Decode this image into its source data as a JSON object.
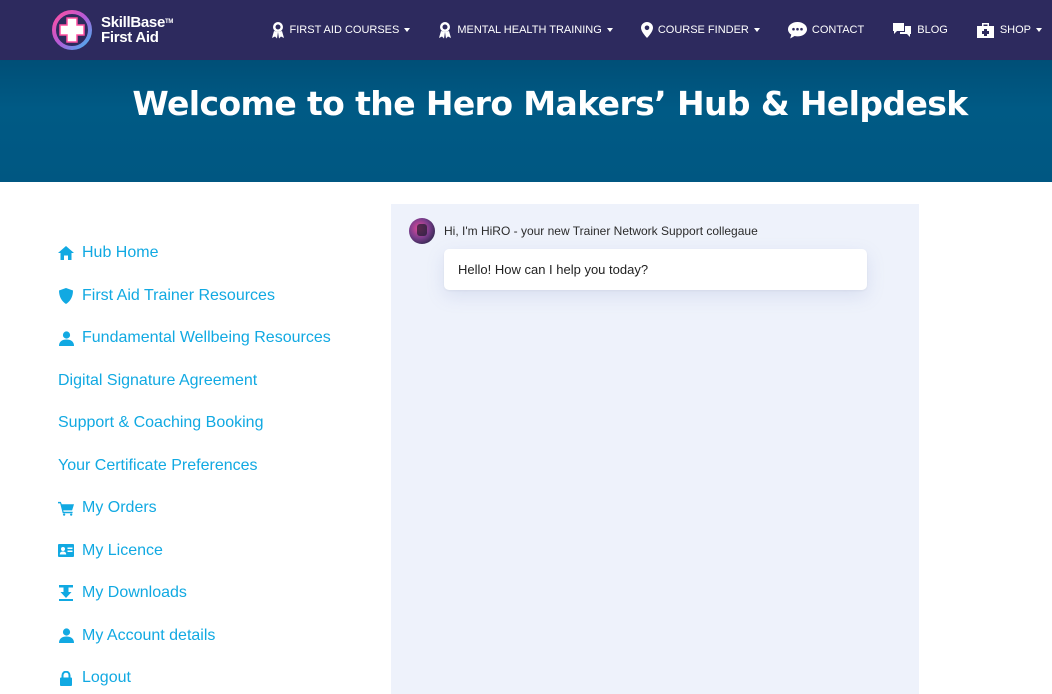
{
  "brand": {
    "name_line1": "SkillBase",
    "name_line2": "First Aid",
    "trademark": "TM",
    "colors": {
      "navbar": "#2d2a5e",
      "hero": "#005a85",
      "link": "#11a9e2",
      "chat_bg": "#eef2fb"
    }
  },
  "nav": {
    "items": [
      {
        "label": "FIRST AID COURSES",
        "icon": "award-icon",
        "dropdown": true
      },
      {
        "label": "MENTAL HEALTH TRAINING",
        "icon": "award-icon",
        "dropdown": true
      },
      {
        "label": "COURSE FINDER",
        "icon": "map-pin-icon",
        "dropdown": true
      },
      {
        "label": "CONTACT",
        "icon": "chat-bubble-icon",
        "dropdown": false
      },
      {
        "label": "BLOG",
        "icon": "comments-icon",
        "dropdown": false
      },
      {
        "label": "SHOP",
        "icon": "medkit-icon",
        "dropdown": true
      }
    ]
  },
  "hero": {
    "title": "Welcome to the Hero Makers’ Hub & Helpdesk"
  },
  "sidebar": {
    "items": [
      {
        "label": "Hub Home",
        "icon": "home-icon"
      },
      {
        "label": "First Aid Trainer Resources",
        "icon": "shield-icon"
      },
      {
        "label": "Fundamental Wellbeing Resources",
        "icon": "user-icon"
      },
      {
        "label": "Digital Signature Agreement",
        "icon": ""
      },
      {
        "label": "Support & Coaching Booking",
        "icon": ""
      },
      {
        "label": "Your Certificate Preferences",
        "icon": ""
      },
      {
        "label": "My Orders",
        "icon": "cart-icon"
      },
      {
        "label": "My Licence",
        "icon": "id-card-icon"
      },
      {
        "label": "My Downloads",
        "icon": "download-icon"
      },
      {
        "label": "My Account details",
        "icon": "user-icon"
      },
      {
        "label": "Logout",
        "icon": "lock-icon"
      }
    ]
  },
  "chat": {
    "bot_name": "Hi, I'm HiRO - your new Trainer Network Support collegaue",
    "message": "Hello! How can I help you today?"
  }
}
